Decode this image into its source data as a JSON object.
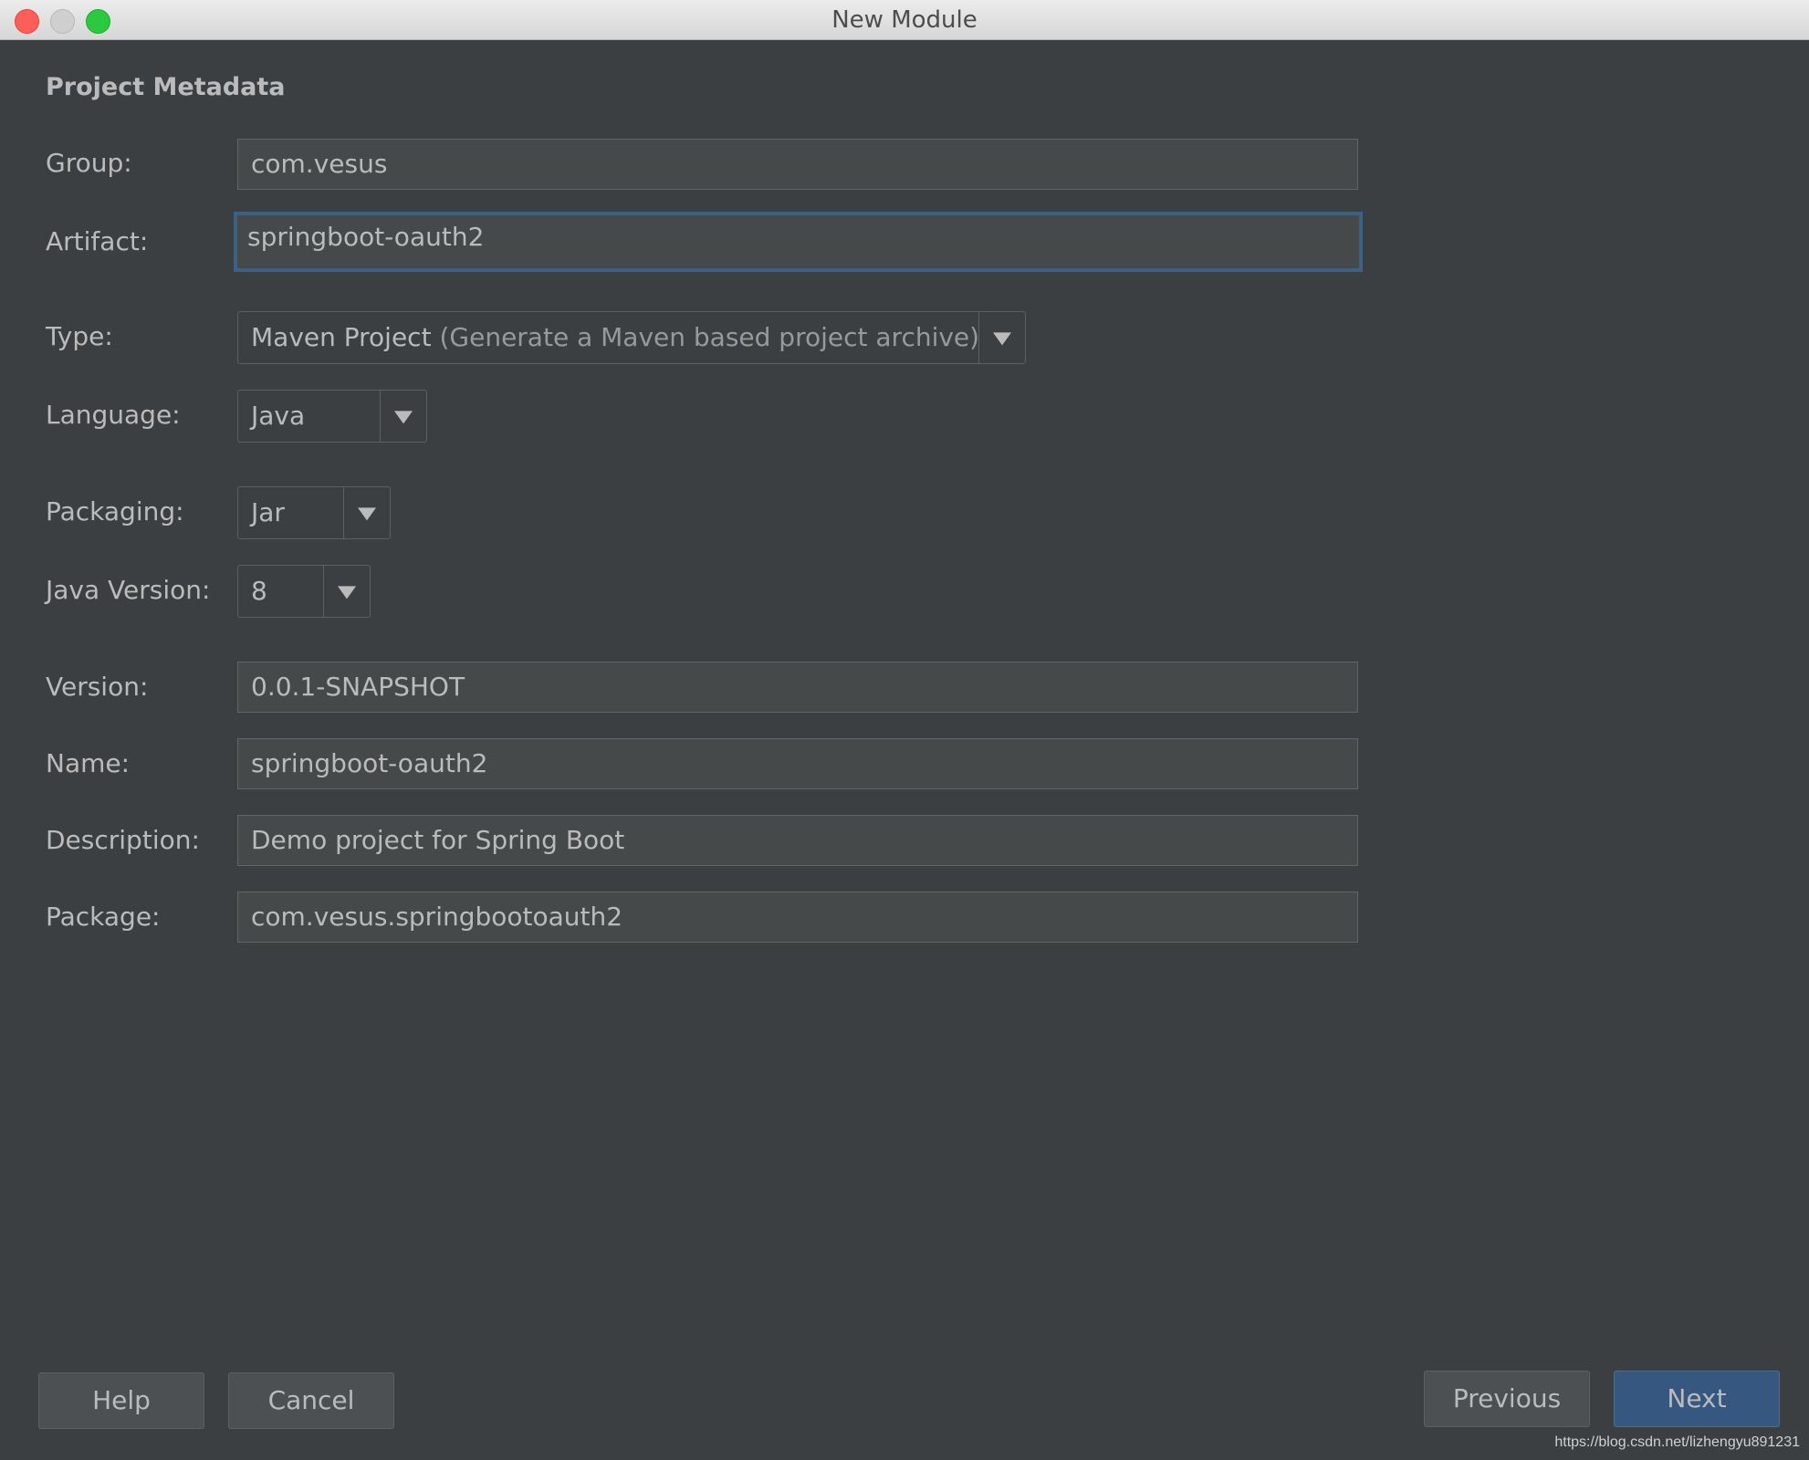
{
  "window": {
    "title": "New Module"
  },
  "section": {
    "title": "Project Metadata"
  },
  "form": {
    "group": {
      "label": "Group:",
      "value": "com.vesus"
    },
    "artifact": {
      "label": "Artifact:",
      "value": "springboot-oauth2"
    },
    "type": {
      "label": "Type:",
      "value": "Maven Project",
      "hint": "(Generate a Maven based project archive)"
    },
    "language": {
      "label": "Language:",
      "value": "Java"
    },
    "packaging": {
      "label": "Packaging:",
      "value": "Jar"
    },
    "java_version": {
      "label": "Java Version:",
      "value": "8"
    },
    "version": {
      "label": "Version:",
      "value": "0.0.1-SNAPSHOT"
    },
    "name": {
      "label": "Name:",
      "value": "springboot-oauth2"
    },
    "description": {
      "label": "Description:",
      "value": "Demo project for Spring Boot"
    },
    "package": {
      "label": "Package:",
      "value": "com.vesus.springbootoauth2"
    }
  },
  "buttons": {
    "help": "Help",
    "cancel": "Cancel",
    "previous": "Previous",
    "next": "Next"
  },
  "watermark": "https://blog.csdn.net/lizhengyu891231",
  "colors": {
    "background": "#3c3f41",
    "field_bg": "#45494a",
    "focus_border": "#3d6185",
    "primary_button": "#365880"
  }
}
